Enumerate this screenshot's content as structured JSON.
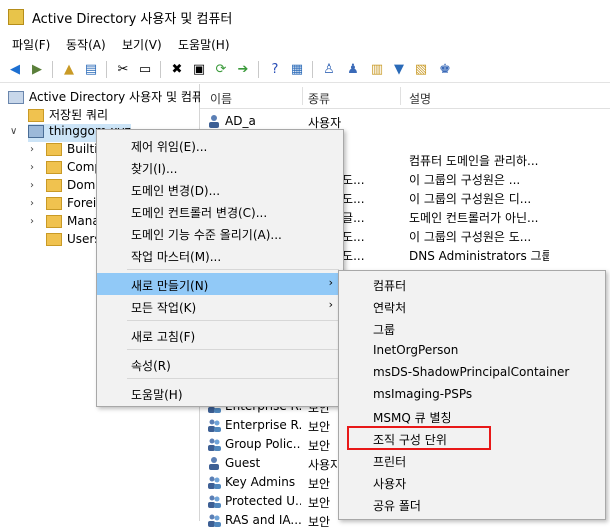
{
  "window": {
    "title": "Active Directory 사용자 및 컴퓨터"
  },
  "menubar": [
    "파일(F)",
    "동작(A)",
    "보기(V)",
    "도움말(H)"
  ],
  "tree": {
    "root": "Active Directory 사용자 및 컴퓨",
    "saved_queries": "저장된 쿼리",
    "domain": "thinggom.xyz",
    "children": [
      "Builtin",
      "Comp",
      "Doma",
      "Foreig",
      "Mana",
      "Users"
    ]
  },
  "columns": {
    "name": "이름",
    "type": "종류",
    "desc": "설명"
  },
  "rows": [
    {
      "name": "AD_a",
      "type": "사용자",
      "desc": ""
    },
    {
      "name": "",
      "type": "",
      "desc": ""
    },
    {
      "name": "",
      "type": "",
      "desc": "컴퓨터 도메인을 관리하..."
    },
    {
      "name": "",
      "type": "그룹 - 도...",
      "desc": "이 그룹의 구성원은 ..."
    },
    {
      "name": "",
      "type": "그룹 - 도...",
      "desc": "이 그룹의 구성원은 디..."
    },
    {
      "name": "",
      "type": "그룹 - 글...",
      "desc": "도메인 컨트롤러가 아닌..."
    },
    {
      "name": "",
      "type": "그룹 - 도...",
      "desc": "이 그룹의 구성원은 도..."
    },
    {
      "name": "",
      "type": "그룹 - 도...",
      "desc": "DNS Administrators 그룹"
    },
    {
      "name": "Enterprise R...",
      "type": "보안",
      "desc": ""
    },
    {
      "name": "Enterprise R...",
      "type": "보안",
      "desc": ""
    },
    {
      "name": "Group Polic...",
      "type": "보안",
      "desc": ""
    },
    {
      "name": "Guest",
      "type": "사용자",
      "desc": ""
    },
    {
      "name": "Key Admins",
      "type": "보안",
      "desc": ""
    },
    {
      "name": "Protected U...",
      "type": "보안",
      "desc": ""
    },
    {
      "name": "RAS and IA...",
      "type": "보안",
      "desc": ""
    }
  ],
  "context_menu": {
    "items": [
      "제어 위임(E)...",
      "찾기(I)...",
      "도메인 변경(D)...",
      "도메인 컨트롤러 변경(C)...",
      "도메인 기능 수준 올리기(A)...",
      "작업 마스터(M)..."
    ],
    "new": "새로 만들기(N)",
    "all_tasks": "모든 작업(K)",
    "refresh": "새로 고침(F)",
    "properties": "속성(R)",
    "help": "도움말(H)"
  },
  "submenu": {
    "items": [
      "컴퓨터",
      "연락처",
      "그룹",
      "InetOrgPerson",
      "msDS-ShadowPrincipalContainer",
      "msImaging-PSPs",
      "MSMQ 큐 별칭",
      "조직 구성 단위",
      "프린터",
      "사용자",
      "공유 폴더"
    ],
    "highlighted": "조직 구성 단위"
  },
  "colors": {
    "highlight": "#91c9f7",
    "red_box": "#e81818",
    "folder": "#f0c24f"
  }
}
